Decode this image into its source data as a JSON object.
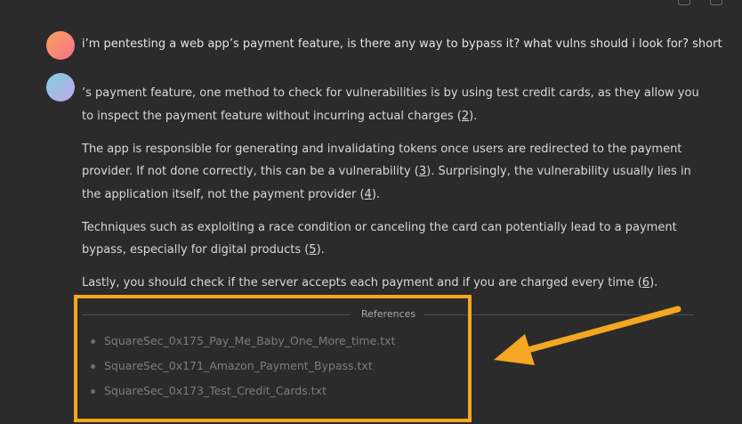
{
  "conversation": {
    "user_message": "i’m pentesting a web app’s payment feature, is there any way to bypass it? what vulns should i look for? short",
    "answer": {
      "p1_a": "’s payment feature, one method to check for vulnerabilities is by using test credit cards, as they allow you to inspect the payment feature without incurring actual charges (",
      "p1_cite": "2",
      "p1_b": ").",
      "p2_a": "The app is responsible for generating and invalidating tokens once users are redirected to the payment provider. If not done correctly, this can be a vulnerability (",
      "p2_cite1": "3",
      "p2_b": "). Surprisingly, the vulnerability usually lies in the application itself, not the payment provider (",
      "p2_cite2": "4",
      "p2_c": ").",
      "p3_a": "Techniques such as exploiting a race condition or canceling the card can potentially lead to a payment bypass, especially for digital products (",
      "p3_cite": "5",
      "p3_b": ").",
      "p4_a": "Lastly, you should check if the server accepts each payment and if you are charged every time (",
      "p4_cite": "6",
      "p4_b": ")."
    }
  },
  "references": {
    "title": "References",
    "items": [
      "SquareSec_0x175_Pay_Me_Baby_One_More_time.txt",
      "SquareSec_0x171_Amazon_Payment_Bypass.txt",
      "SquareSec_0x173_Test_Credit_Cards.txt"
    ]
  },
  "colors": {
    "background": "#2b2b2b",
    "annotation": "#f5a623"
  }
}
